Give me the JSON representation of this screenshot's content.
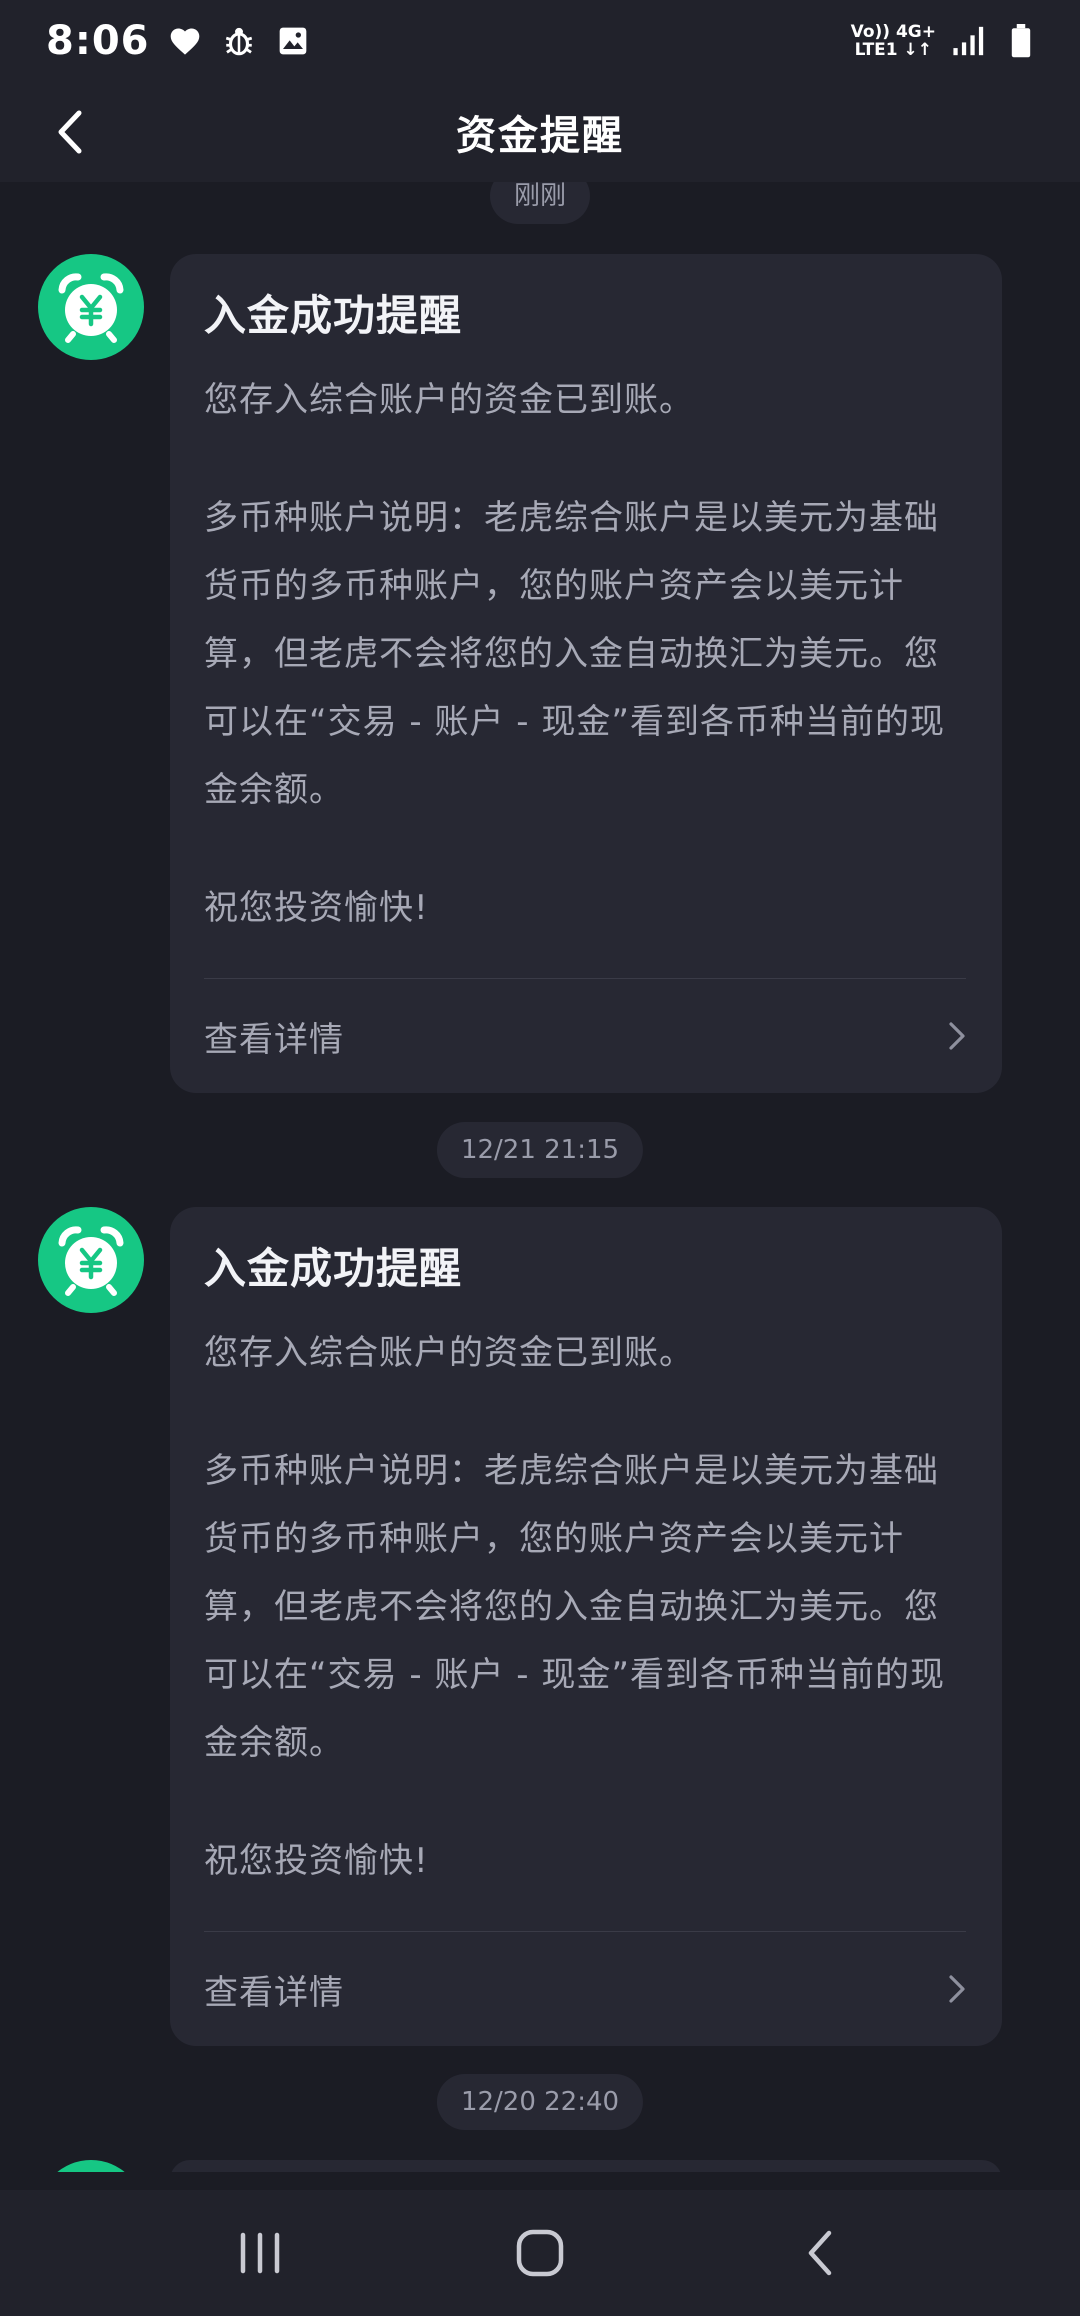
{
  "status_bar": {
    "time": "8:06",
    "network_top": "Vo)) 4G+",
    "network_bottom": "LTE1 ↓↑",
    "icons": [
      "heart-icon",
      "bug-icon",
      "image-icon",
      "signal-icon",
      "battery-icon"
    ]
  },
  "header": {
    "title": "资金提醒",
    "back_icon": "chevron-left-icon"
  },
  "messages": [
    {
      "time": "刚刚",
      "title": "入金成功提醒",
      "line1": "您存入综合账户的资金已到账。",
      "desc_lines": [
        "多币种账户说明：老虎综合账户是以美元为基础",
        "货币的多币种账户，您的账户资产会以美元计",
        "算，但老虎不会将您的入金自动换汇为美元。您",
        "可以在“交易 - 账户 - 现金”看到各币种当前的现",
        "金余额。"
      ],
      "closing": "祝您投资愉快!",
      "detail_label": "查看详情"
    },
    {
      "time": "12/21 21:15",
      "title": "入金成功提醒",
      "line1": "您存入综合账户的资金已到账。",
      "desc_lines": [
        "多币种账户说明：老虎综合账户是以美元为基础",
        "货币的多币种账户，您的账户资产会以美元计",
        "算，但老虎不会将您的入金自动换汇为美元。您",
        "可以在“交易 - 账户 - 现金”看到各币种当前的现",
        "金余额。"
      ],
      "closing": "祝您投资愉快!",
      "detail_label": "查看详情"
    },
    {
      "time": "12/20 22:40"
    }
  ],
  "colors": {
    "accent": "#16c784",
    "background": "#1b1c24",
    "card": "#272833",
    "bar": "#21222b"
  }
}
